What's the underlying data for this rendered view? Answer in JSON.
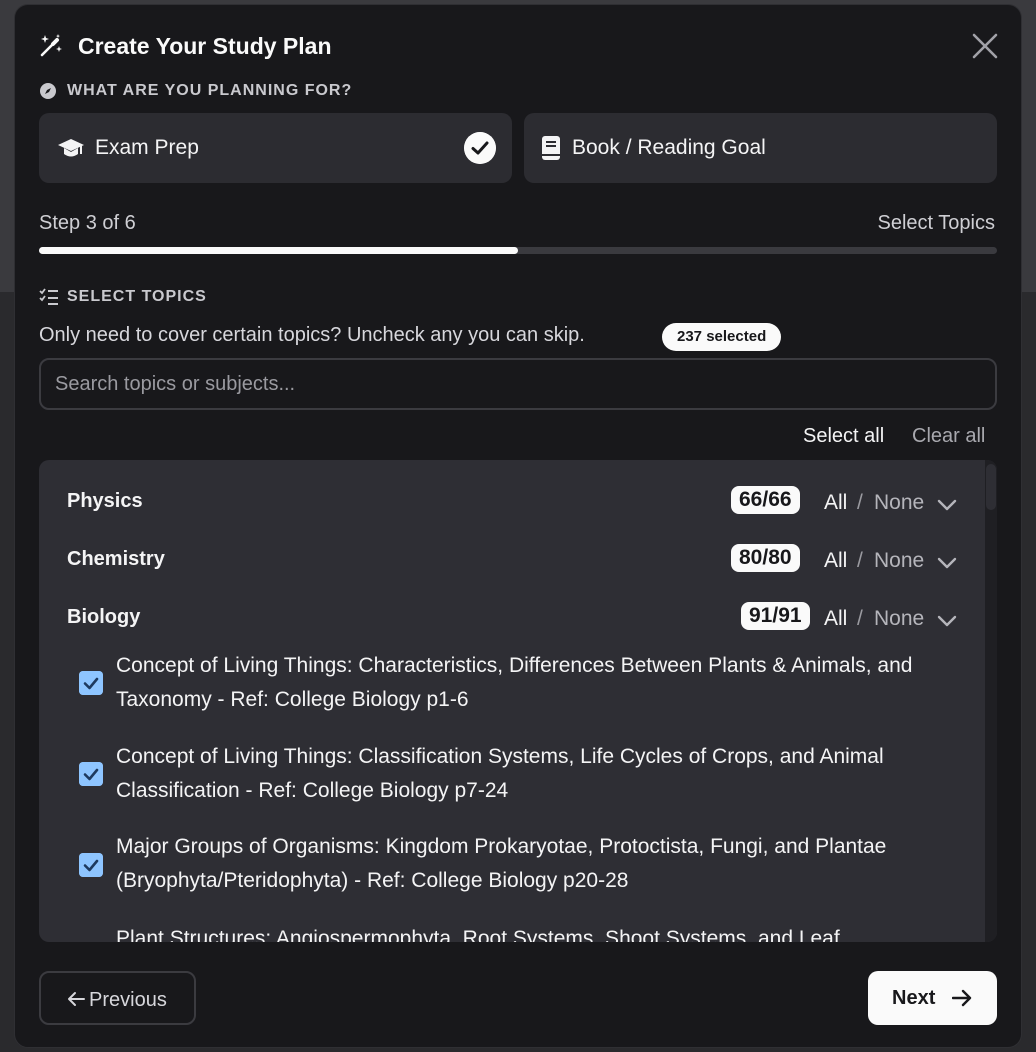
{
  "modal": {
    "title": "Create Your Study Plan",
    "title_icon": "magic-wand-icon",
    "close_icon": "close-icon"
  },
  "planning": {
    "label": "WHAT ARE YOU PLANNING FOR?",
    "label_icon": "compass-icon",
    "options": [
      {
        "label": "Exam Prep",
        "icon": "graduation-cap-icon",
        "selected": true
      },
      {
        "label": "Book / Reading Goal",
        "icon": "book-icon",
        "selected": false
      }
    ]
  },
  "step": {
    "text": "Step 3 of 6",
    "name": "Select Topics",
    "progress": 0.5
  },
  "topics": {
    "label": "SELECT TOPICS",
    "label_icon": "list-checks-icon",
    "description": "Only need to cover certain topics? Uncheck any you can skip.",
    "selected_badge": "237 selected",
    "search_placeholder": "Search topics or subjects...",
    "select_all": "Select all",
    "clear_all": "Clear all",
    "all_label": "All",
    "slash": "/",
    "none_label": "None",
    "subjects": [
      {
        "name": "Physics",
        "count": "66/66"
      },
      {
        "name": "Chemistry",
        "count": "80/80"
      },
      {
        "name": "Biology",
        "count": "91/91"
      }
    ],
    "items": [
      {
        "text": "Concept of Living Things: Characteristics, Differences Between Plants & Animals, and Taxonomy - Ref: College Biology p1-6",
        "checked": true
      },
      {
        "text": "Concept of Living Things: Classification Systems, Life Cycles of Crops, and Animal Classification - Ref: College Biology p7-24",
        "checked": true
      },
      {
        "text": "Major Groups of Organisms: Kingdom Prokaryotae, Protoctista, Fungi, and Plantae (Bryophyta/Pteridophyta) - Ref: College Biology p20-28",
        "checked": true
      },
      {
        "text": "Plant Structures: Angiospermophyta, Root Systems, Shoot Systems, and Leaf",
        "checked": true
      }
    ]
  },
  "footer": {
    "previous": "Previous",
    "next": "Next"
  },
  "colors": {
    "background": "#18181b",
    "card": "#2c2c31",
    "accent": "#fafafa",
    "checkbox": "#8ec5ff"
  }
}
